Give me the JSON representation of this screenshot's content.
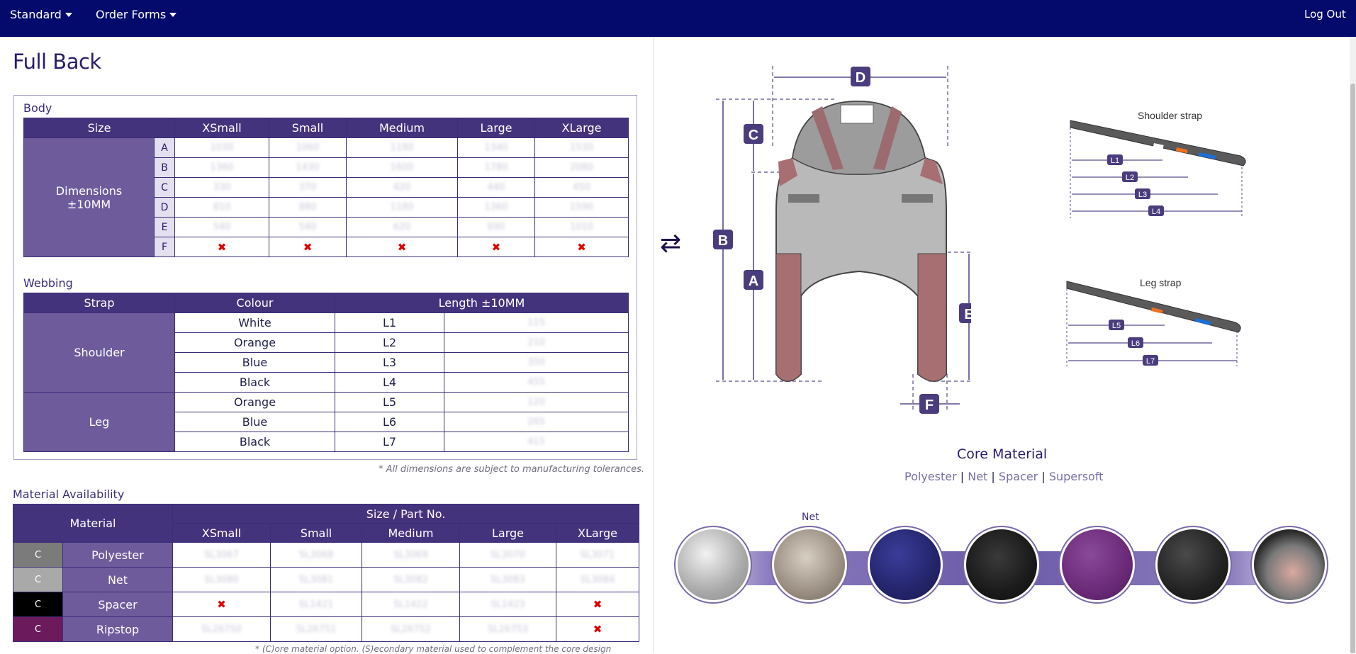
{
  "nav": {
    "standard": "Standard",
    "order_forms": "Order Forms",
    "logout": "Log Out"
  },
  "page_title": "Full Back",
  "body_table": {
    "section": "Body",
    "size_header": "Size",
    "sizes": [
      "XSmall",
      "Small",
      "Medium",
      "Large",
      "XLarge"
    ],
    "dimensions_label": "Dimensions",
    "tolerance": "±10MM",
    "rows": [
      {
        "letter": "A",
        "values": [
          "1030",
          "1060",
          "1180",
          "1340",
          "1530"
        ]
      },
      {
        "letter": "B",
        "values": [
          "1360",
          "1430",
          "1600",
          "1780",
          "2080"
        ]
      },
      {
        "letter": "C",
        "values": [
          "330",
          "370",
          "420",
          "440",
          "450"
        ]
      },
      {
        "letter": "D",
        "values": [
          "810",
          "880",
          "1180",
          "1360",
          "1590"
        ]
      },
      {
        "letter": "E",
        "values": [
          "540",
          "540",
          "620",
          "690",
          "1010"
        ]
      },
      {
        "letter": "F",
        "values": [
          "✖",
          "✖",
          "✖",
          "✖",
          "✖"
        ]
      }
    ]
  },
  "webbing_table": {
    "section": "Webbing",
    "headers": [
      "Strap",
      "Colour",
      "Length ±10MM"
    ],
    "groups": [
      {
        "strap": "Shoulder",
        "rows": [
          {
            "colour": "White",
            "code": "L1",
            "length": "115"
          },
          {
            "colour": "Orange",
            "code": "L2",
            "length": "210"
          },
          {
            "colour": "Blue",
            "code": "L3",
            "length": "350"
          },
          {
            "colour": "Black",
            "code": "L4",
            "length": "455"
          }
        ]
      },
      {
        "strap": "Leg",
        "rows": [
          {
            "colour": "Orange",
            "code": "L5",
            "length": "120"
          },
          {
            "colour": "Blue",
            "code": "L6",
            "length": "265"
          },
          {
            "colour": "Black",
            "code": "L7",
            "length": "415"
          }
        ]
      }
    ]
  },
  "tolerance_note": "* All dimensions are subject to manufacturing tolerances.",
  "material_table": {
    "section": "Material Availability",
    "material_header": "Material",
    "size_part_header": "Size / Part No.",
    "sizes": [
      "XSmall",
      "Small",
      "Medium",
      "Large",
      "XLarge"
    ],
    "rows": [
      {
        "badge": "C",
        "badge_color": "#7b7b7b",
        "name": "Polyester",
        "parts": [
          "SL3067",
          "SL3068",
          "SL3069",
          "SL3070",
          "SL3071"
        ]
      },
      {
        "badge": "C",
        "badge_color": "#a9a9a9",
        "name": "Net",
        "parts": [
          "SL3080",
          "SL3081",
          "SL3082",
          "SL3083",
          "SL3084"
        ]
      },
      {
        "badge": "C",
        "badge_color": "#000000",
        "name": "Spacer",
        "parts": [
          "✖",
          "SL1421",
          "SL1422",
          "SL1423",
          "✖"
        ]
      },
      {
        "badge": "C",
        "badge_color": "#6b1a5c",
        "name": "Ripstop",
        "parts": [
          "SL26750",
          "SL26751",
          "SL26752",
          "SL26753",
          "✖"
        ]
      }
    ]
  },
  "core_note": "* (C)ore material option. (S)econdary material used to complement the core design",
  "diagram": {
    "labels": {
      "a": "A",
      "b": "B",
      "c": "C",
      "d": "D",
      "e": "E",
      "f": "F"
    },
    "shoulder_strap": "Shoulder strap",
    "leg_strap": "Leg strap",
    "shoulder_marks": {
      "l1": "L1",
      "l2": "L2",
      "l3": "L3",
      "l4": "L4"
    },
    "leg_marks": {
      "l5": "L5",
      "l6": "L6",
      "l7": "L7"
    },
    "swap_icon": "⇄"
  },
  "core_material": {
    "title": "Core Material",
    "items": [
      "Polyester",
      "Net",
      "Spacer",
      "Supersoft"
    ],
    "separator": "|",
    "hover_label": "Net"
  },
  "colors": {
    "nav": "#030a6b",
    "header": "#43337c",
    "label": "#6d5b9c"
  }
}
